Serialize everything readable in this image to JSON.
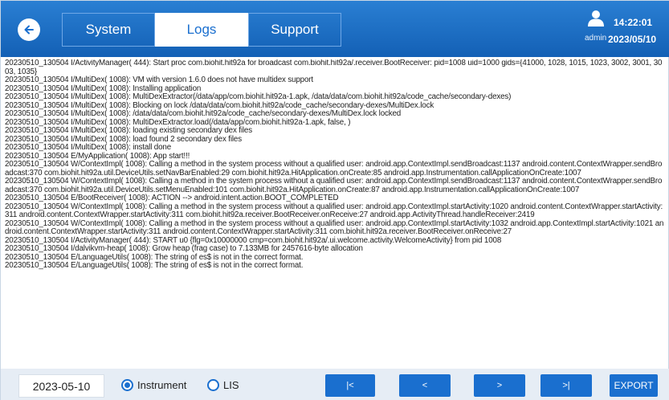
{
  "header": {
    "tabs": [
      {
        "label": "System",
        "active": false
      },
      {
        "label": "Logs",
        "active": true
      },
      {
        "label": "Support",
        "active": false
      }
    ],
    "user": {
      "label": "admin"
    },
    "clock": {
      "time": "14:22:01",
      "date": "2023/05/10"
    },
    "colors": {
      "bar": "#1a6fcf",
      "active_tab_bg": "#ffffff"
    }
  },
  "log": {
    "lines": [
      "20230510_130504 I/ActivityManager( 444): Start proc com.biohit.hit92a for broadcast com.biohit.hit92a/.receiver.BootReceiver: pid=1008 uid=1000 gids={41000, 1028, 1015, 1023, 3002, 3001, 3003, 1035}",
      "20230510_130504 I/MultiDex( 1008): VM with version 1.6.0 does not have multidex support",
      "20230510_130504 I/MultiDex( 1008): Installing application",
      "20230510_130504 I/MultiDex( 1008): MultiDexExtractor(/data/app/com.biohit.hit92a-1.apk, /data/data/com.biohit.hit92a/code_cache/secondary-dexes)",
      "20230510_130504 I/MultiDex( 1008): Blocking on lock /data/data/com.biohit.hit92a/code_cache/secondary-dexes/MultiDex.lock",
      "20230510_130504 I/MultiDex( 1008): /data/data/com.biohit.hit92a/code_cache/secondary-dexes/MultiDex.lock locked",
      "20230510_130504 I/MultiDex( 1008): MultiDexExtractor.load(/data/app/com.biohit.hit92a-1.apk, false, )",
      "20230510_130504 I/MultiDex( 1008): loading existing secondary dex files",
      "20230510_130504 I/MultiDex( 1008): load found 2 secondary dex files",
      "20230510_130504 I/MultiDex( 1008): install done",
      "20230510_130504 E/MyApplication( 1008): App start!!!",
      "20230510_130504 W/ContextImpl( 1008): Calling a method in the system process without a qualified user: android.app.ContextImpl.sendBroadcast:1137 android.content.ContextWrapper.sendBroadcast:370 com.biohit.hit92a.util.DeviceUtils.setNavBarEnabled:29 com.biohit.hit92a.HitApplication.onCreate:85 android.app.Instrumentation.callApplicationOnCreate:1007",
      "20230510_130504 W/ContextImpl( 1008): Calling a method in the system process without a qualified user: android.app.ContextImpl.sendBroadcast:1137 android.content.ContextWrapper.sendBroadcast:370 com.biohit.hit92a.util.DeviceUtils.setMenuEnabled:101 com.biohit.hit92a.HitApplication.onCreate:87 android.app.Instrumentation.callApplicationOnCreate:1007",
      "20230510_130504 E/BootReceiver( 1008): ACTION --> android.intent.action.BOOT_COMPLETED",
      "20230510_130504 W/ContextImpl( 1008): Calling a method in the system process without a qualified user: android.app.ContextImpl.startActivity:1020 android.content.ContextWrapper.startActivity:311 android.content.ContextWrapper.startActivity:311 com.biohit.hit92a.receiver.BootReceiver.onReceive:27 android.app.ActivityThread.handleReceiver:2419",
      "20230510_130504 W/ContextImpl( 1008): Calling a method in the system process without a qualified user: android.app.ContextImpl.startActivity:1032 android.app.ContextImpl.startActivity:1021 android.content.ContextWrapper.startActivity:311 android.content.ContextWrapper.startActivity:311 com.biohit.hit92a.receiver.BootReceiver.onReceive:27",
      "20230510_130504 I/ActivityManager( 444): START u0 {flg=0x10000000 cmp=com.biohit.hit92a/.ui.welcome.activity.WelcomeActivity} from pid 1008",
      "20230510_130504 I/dalvikvm-heap( 1008): Grow heap (frag case) to 7.133MB for 2457616-byte allocation",
      "20230510_130504 E/LanguageUtils( 1008): The string of es$ is not in the correct format.",
      "20230510_130504 E/LanguageUtils( 1008): The string of es$ is not in the correct format."
    ]
  },
  "footer": {
    "date_filter": "2023-05-10",
    "radio_instrument": "Instrument",
    "radio_lis": "LIS",
    "selected_source": "Instrument",
    "btn_first": "|<",
    "btn_prev": "<",
    "btn_next": ">",
    "btn_last": ">|",
    "btn_export": "EXPORT"
  }
}
